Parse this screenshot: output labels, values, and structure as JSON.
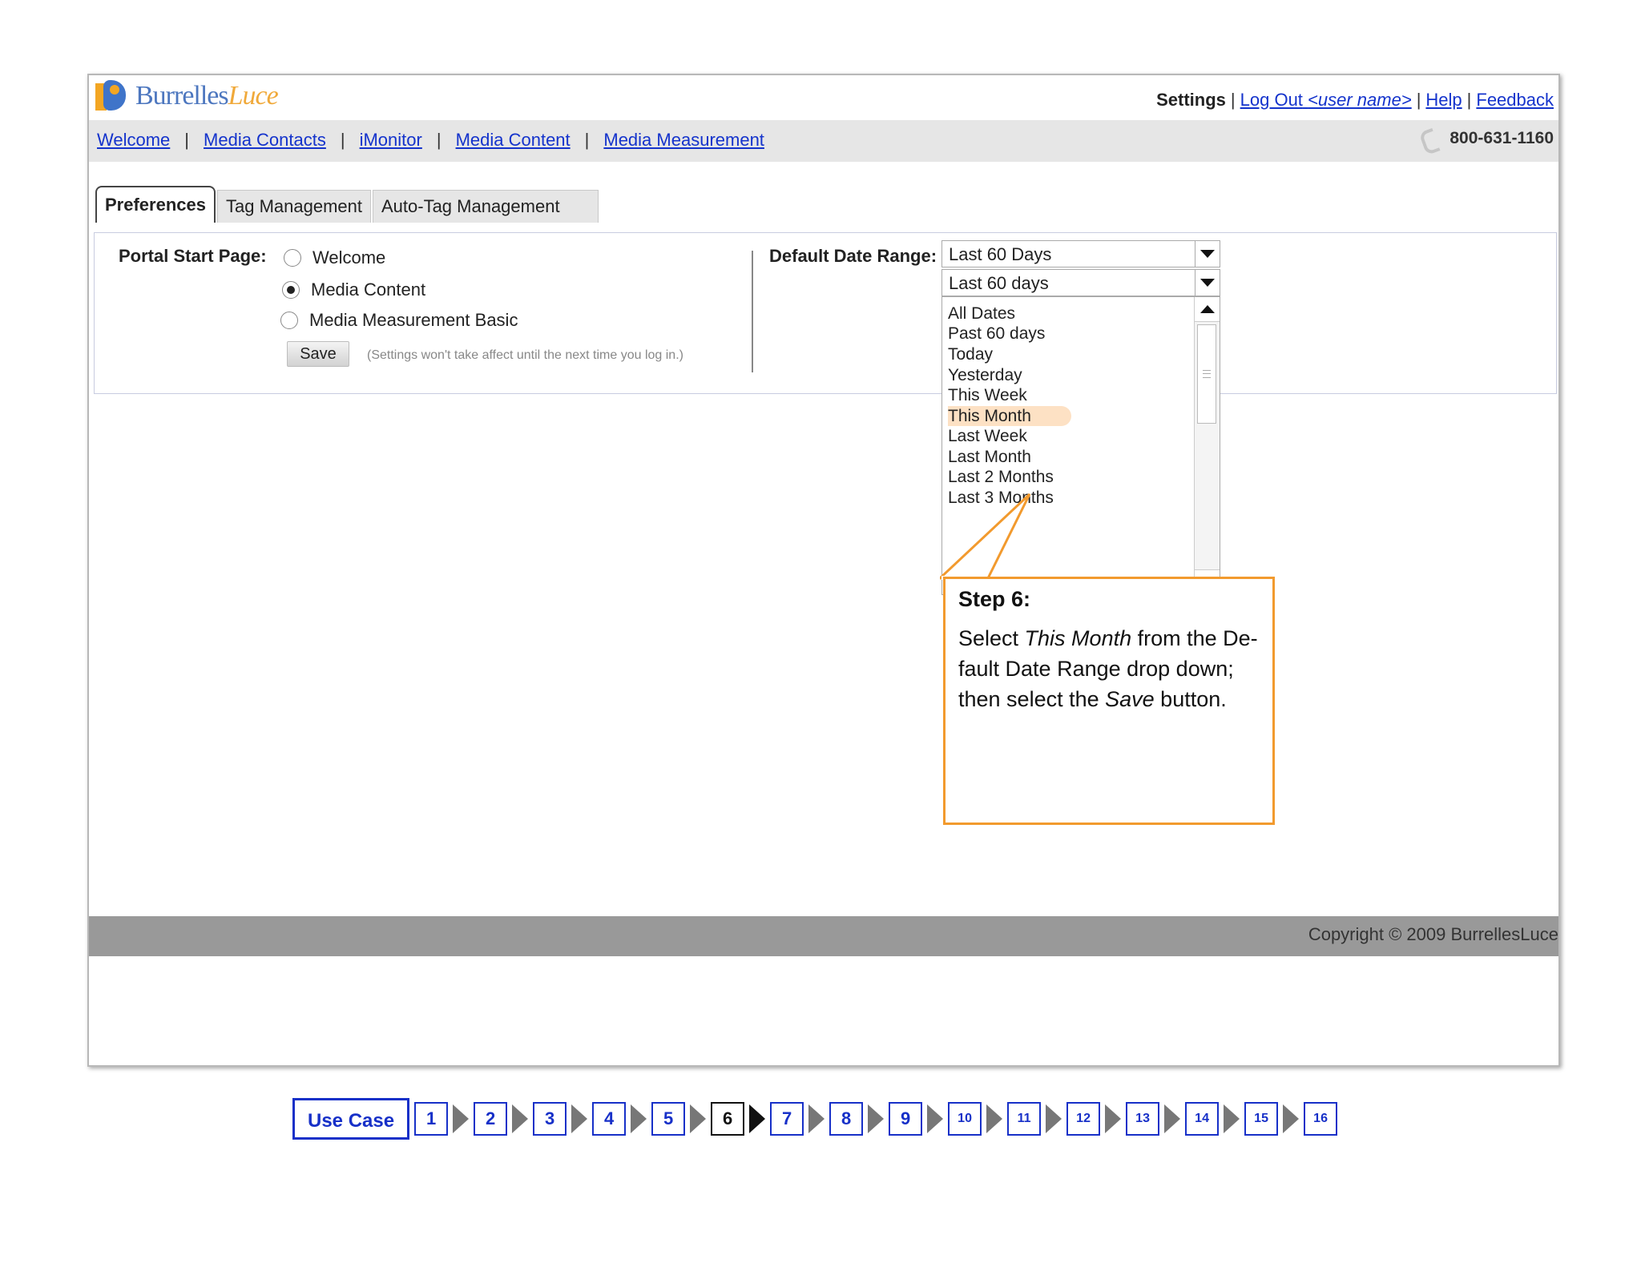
{
  "header": {
    "logo_primary": "Burrelles",
    "logo_accent": "Luce",
    "settings_label": "Settings",
    "logout_label": "Log Out",
    "logout_user": "<user name>",
    "help_label": "Help",
    "feedback_label": "Feedback",
    "separator": "|"
  },
  "nav": {
    "items": [
      "Welcome",
      "Media Contacts",
      "iMonitor",
      "Media Content",
      "Media Measurement"
    ],
    "separator": "|",
    "phone": "800-631-1160"
  },
  "tabs": [
    "Preferences",
    "Tag Management",
    "Auto-Tag Management"
  ],
  "preferences": {
    "portal_start_label": "Portal Start Page:",
    "radio_options": [
      "Welcome",
      "Media Content",
      "Media Measurement Basic"
    ],
    "selected_option": "Media Content",
    "save_label": "Save",
    "note": "(Settings won't take affect until the next time you log in.)",
    "date_range_label": "Default Date Range:",
    "date_range_value": "Last 60 Days",
    "dropdown_value": "Last 60 days",
    "dropdown_options": [
      "All Dates",
      "Past 60 days",
      "Today",
      "Yesterday",
      "This Week",
      "This Month",
      "Last Week",
      "Last Month",
      "Last 2 Months",
      "Last 3 Months"
    ],
    "highlighted_option": "This Month"
  },
  "callout": {
    "title": "Step 6:",
    "line1_pre": "Select ",
    "line1_em": "This Month",
    "line1_post": " from the De-",
    "line2": "fault Date Range drop down;",
    "line3_pre": "then select the ",
    "line3_em": "Save",
    "line3_post": " button.",
    "border_color": "#f29a2e"
  },
  "footer": {
    "copyright": "Copyright © 2009 BurrellesLuce"
  },
  "step_nav": {
    "use_case_label": "Use Case",
    "steps": [
      "1",
      "2",
      "3",
      "4",
      "5",
      "6",
      "7",
      "8",
      "9",
      "10",
      "11",
      "12",
      "13",
      "14",
      "15",
      "16"
    ],
    "current_step": "6",
    "accent_color": "#1730c8"
  }
}
